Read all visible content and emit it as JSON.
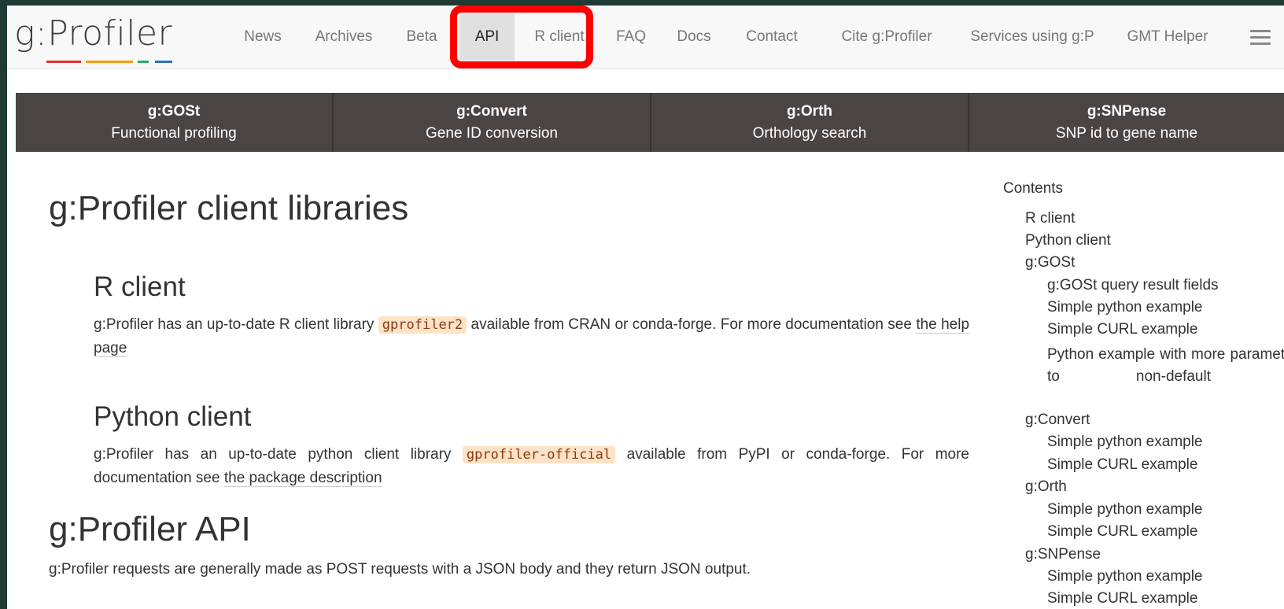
{
  "logo": {
    "text": "g:Profiler",
    "bar_colors": [
      "#d9342b",
      "#f39c12",
      "#27ae60",
      "#2c6fbb"
    ]
  },
  "nav": {
    "items": [
      "News",
      "Archives",
      "Beta",
      "API",
      "R client",
      "FAQ",
      "Docs",
      "Contact",
      "Cite g:Profiler",
      "Services using g:P",
      "GMT Helper"
    ],
    "active": "API"
  },
  "tools": [
    {
      "name": "g:GOSt",
      "desc": "Functional profiling"
    },
    {
      "name": "g:Convert",
      "desc": "Gene ID conversion"
    },
    {
      "name": "g:Orth",
      "desc": "Orthology search"
    },
    {
      "name": "g:SNPense",
      "desc": "SNP id to gene name"
    }
  ],
  "main": {
    "title": "g:Profiler client libraries",
    "r_client": {
      "heading": "R client",
      "text_before": "g:Profiler has an up-to-date R client library",
      "code": "gprofiler2",
      "text_after": "available from CRAN or conda-forge. For more documentation see",
      "link": "the help page"
    },
    "python_client": {
      "heading": "Python client",
      "text_before": "g:Profiler has an up-to-date python client library",
      "code": "gprofiler-official",
      "text_after": "available from PyPI or conda-forge. For more documentation see",
      "link": "the package description"
    },
    "api": {
      "heading": "g:Profiler API",
      "text": "g:Profiler requests are generally made as POST requests with a JSON body and they return JSON output."
    }
  },
  "toc": {
    "title": "Contents",
    "items": [
      "R client",
      "Python client",
      "g:GOSt",
      "g:GOSt query result fields",
      "Simple python example",
      "Simple CURL example",
      "Python example with more parameters set to non-default values",
      "g:Convert",
      "Simple python example",
      "Simple CURL example",
      "g:Orth",
      "Simple python example",
      "Simple CURL example",
      "g:SNPense",
      "Simple python example",
      "Simple CURL example"
    ]
  }
}
